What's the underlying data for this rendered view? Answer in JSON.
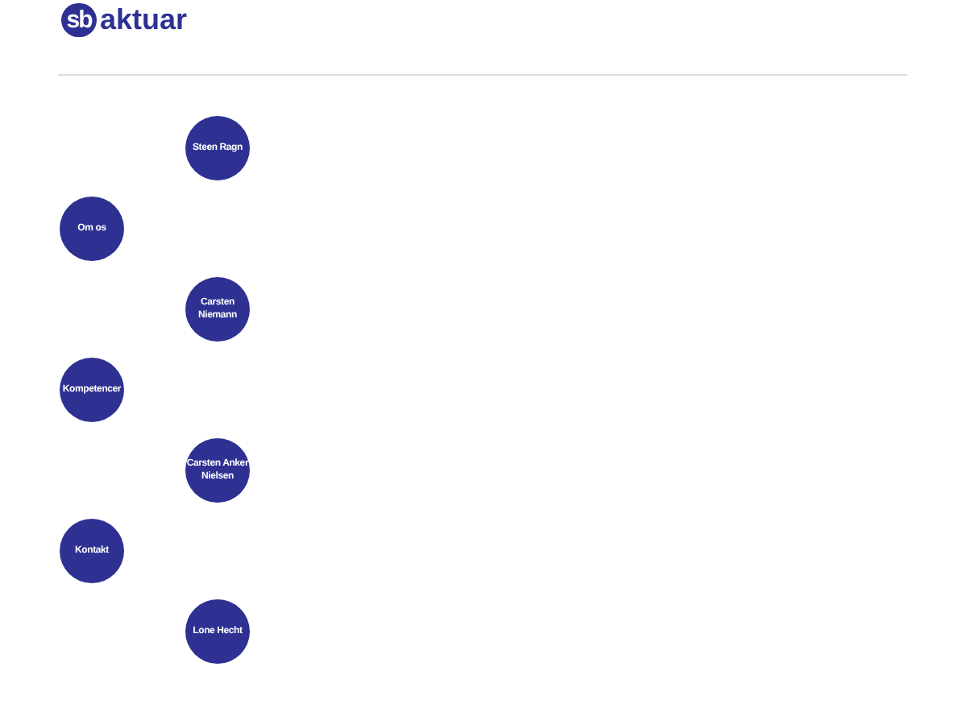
{
  "logo": {
    "mark": "sb",
    "name": "aktuar"
  },
  "items": [
    {
      "kind": "person",
      "label": "Steen Ragn"
    },
    {
      "kind": "nav",
      "label": "Om os"
    },
    {
      "kind": "person",
      "label": "Carsten Niemann"
    },
    {
      "kind": "nav",
      "label": "Kompetencer"
    },
    {
      "kind": "person",
      "label": "Carsten Anker Nielsen"
    },
    {
      "kind": "nav",
      "label": "Kontakt"
    },
    {
      "kind": "person",
      "label": "Lone Hecht"
    }
  ]
}
